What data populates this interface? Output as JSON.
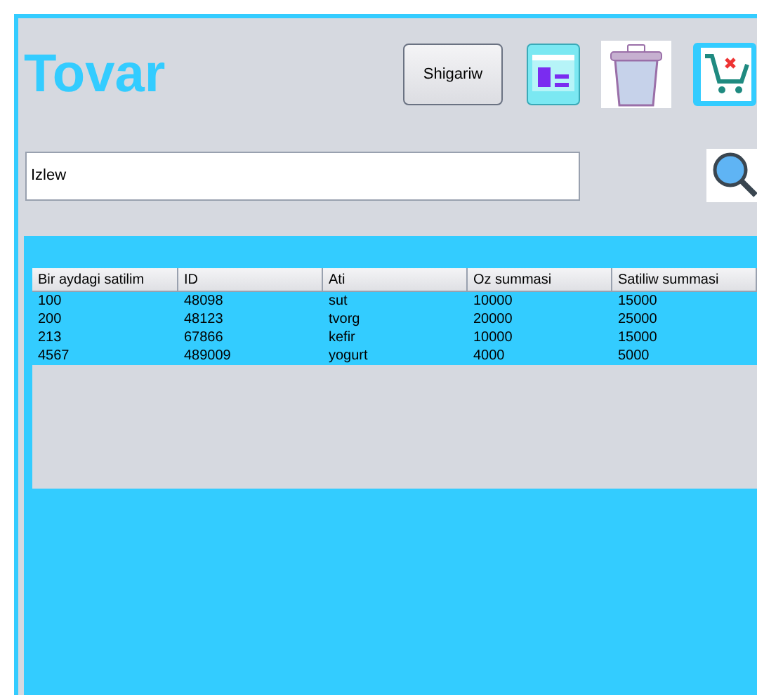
{
  "title": "Tovar",
  "toolbar": {
    "button": "Shigariw"
  },
  "search": {
    "value": "Izlew"
  },
  "table": {
    "columns": [
      "Bir aydagi satilim",
      "ID",
      "Ati",
      "Oz summasi",
      "Satiliw summasi"
    ],
    "rows": [
      [
        "100",
        "48098",
        "sut",
        "10000",
        "15000"
      ],
      [
        "200",
        "48123",
        "tvorg",
        "20000",
        "25000"
      ],
      [
        "213",
        "67866",
        "kefir",
        "10000",
        "15000"
      ],
      [
        "4567",
        "489009",
        "yogurt",
        "4000",
        "5000"
      ]
    ]
  }
}
